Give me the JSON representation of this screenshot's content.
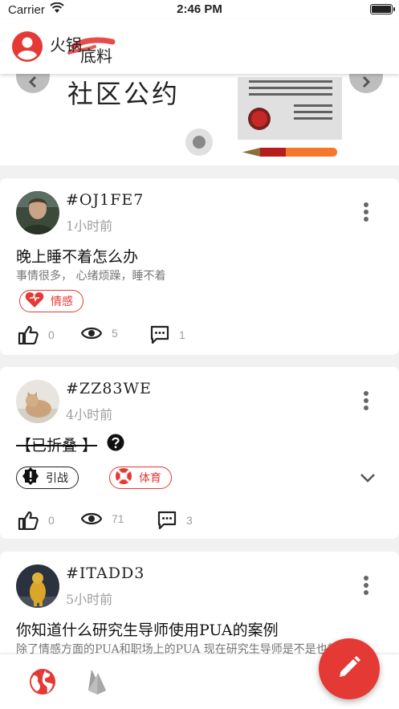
{
  "status_bar": {
    "carrier": "Carrier",
    "time": "2:46 PM"
  },
  "header": {
    "logo_line1": "火锅",
    "logo_line2": "底料"
  },
  "banner": {
    "title": "社区公约"
  },
  "posts": [
    {
      "username": "#OJ1FE7",
      "time": "1小时前",
      "title": "晚上睡不着怎么办",
      "body": "事情很多， 心绪烦躁，睡不着",
      "tags": [
        {
          "label": "情感",
          "icon": "heart-icon"
        }
      ],
      "likes": "0",
      "views": "5",
      "comments": "1"
    },
    {
      "username": "#ZZ83WE",
      "time": "4小时前",
      "title": "【已折叠 】",
      "tags": [
        {
          "label": "引战",
          "icon": "warning-badge-icon"
        },
        {
          "label": "体育",
          "icon": "lifebuoy-icon"
        }
      ],
      "likes": "0",
      "views": "71",
      "comments": "3"
    },
    {
      "username": "#ITADD3",
      "time": "5小时前",
      "title": "你知道什么研究生导师使用PUA的案例",
      "body": "除了情感方面的PUA和职场上的PUA 现在研究生导师是不是也很"
    }
  ],
  "colors": {
    "accent": "#e53935",
    "muted": "#9e9e9e",
    "background": "#f1f1f1"
  },
  "icons": [
    "wifi-icon",
    "battery-icon",
    "account-circle-icon",
    "chevron-left-icon",
    "chevron-right-icon",
    "more-vert-icon",
    "thumb-up-icon",
    "eye-icon",
    "comment-icon",
    "help-circle-icon",
    "chevron-down-icon",
    "globe-icon",
    "fire-icon",
    "pencil-icon"
  ]
}
